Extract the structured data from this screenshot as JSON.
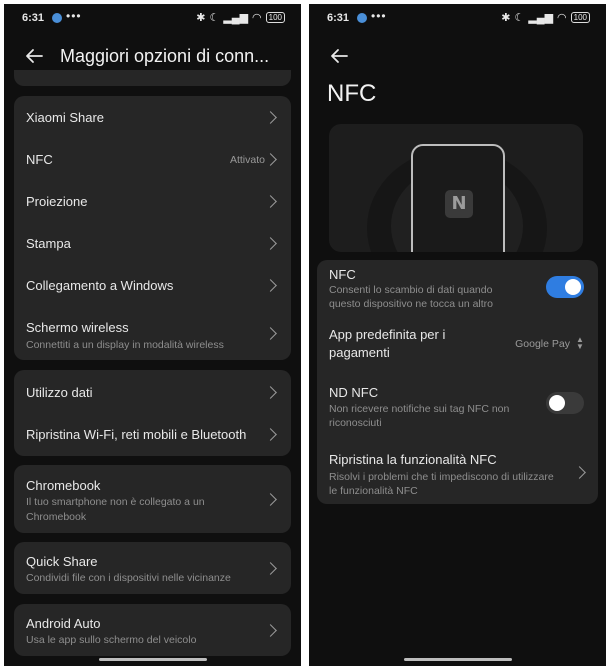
{
  "status": {
    "time": "6:31",
    "dots": "•••",
    "battery": "100"
  },
  "left": {
    "title": "Maggiori opzioni di conn...",
    "groups": [
      {
        "items": [
          {
            "title": "Xiaomi Share"
          },
          {
            "title": "NFC",
            "value": "Attivato"
          },
          {
            "title": "Proiezione"
          },
          {
            "title": "Stampa"
          },
          {
            "title": "Collegamento a Windows"
          },
          {
            "title": "Schermo wireless",
            "subtitle": "Connettiti a un display in modalità wireless"
          }
        ]
      },
      {
        "items": [
          {
            "title": "Utilizzo dati"
          },
          {
            "title": "Ripristina Wi-Fi, reti mobili e Bluetooth"
          }
        ]
      },
      {
        "items": [
          {
            "title": "Chromebook",
            "subtitle_line1": "Il tuo smartphone non è collegato a un",
            "subtitle_line2": "Chromebook"
          }
        ]
      },
      {
        "items": [
          {
            "title": "Quick Share",
            "subtitle": "Condividi file con i dispositivi nelle vicinanze"
          }
        ]
      },
      {
        "items": [
          {
            "title": "Android Auto",
            "subtitle": "Usa le app sullo schermo del veicolo"
          }
        ]
      }
    ]
  },
  "right": {
    "title": "NFC",
    "logo_glyph": "N",
    "items": [
      {
        "title": "NFC",
        "subtitle_line1": "Consenti lo scambio di dati quando",
        "subtitle_line2": "questo dispositivo ne tocca un altro",
        "toggle": true
      },
      {
        "title_line1": "App predefinita per i",
        "title_line2": "pagamenti",
        "value": "Google Pay"
      },
      {
        "title": "ND NFC",
        "subtitle_line1": "Non ricevere notifiche sui tag NFC non",
        "subtitle_line2": "riconosciuti",
        "toggle": false
      },
      {
        "title": "Ripristina la funzionalità NFC",
        "subtitle_line1": "Risolvi i problemi che ti impediscono di utilizzare",
        "subtitle_line2": "le funzionalità NFC"
      }
    ]
  },
  "colors": {
    "accent": "#2f7de1",
    "card": "#262626",
    "background": "#0f0f0f"
  }
}
